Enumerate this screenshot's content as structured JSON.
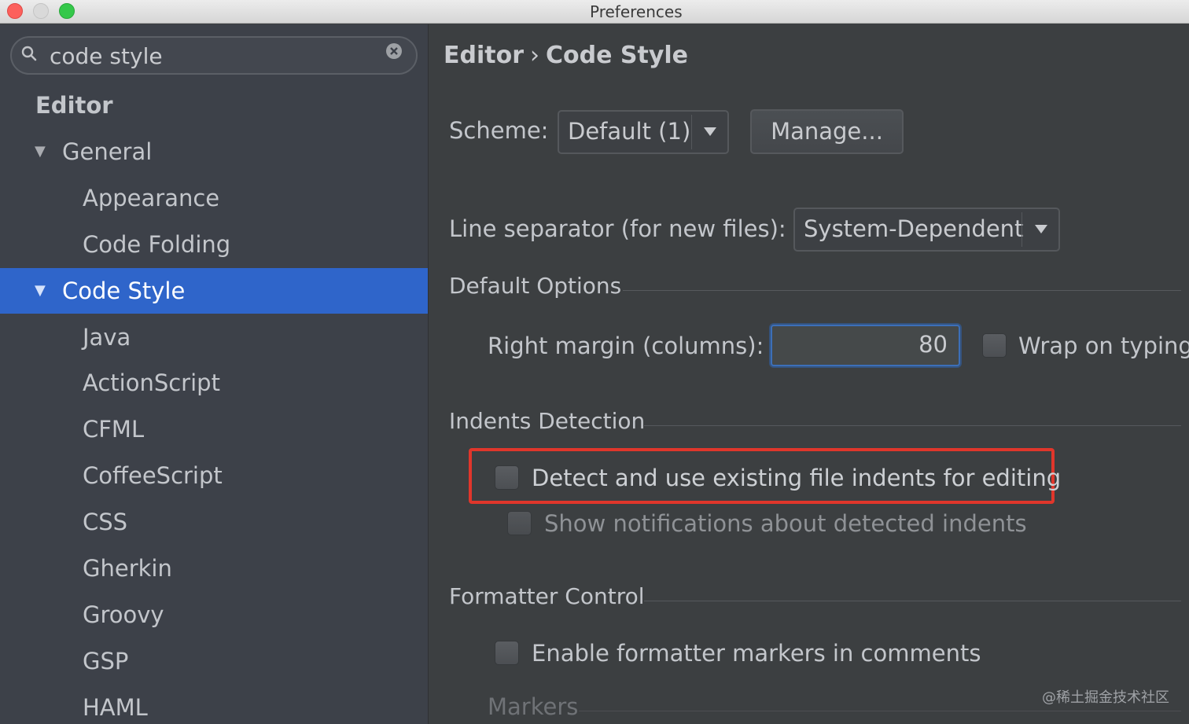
{
  "window": {
    "title": "Preferences"
  },
  "search": {
    "value": "code style"
  },
  "tree": [
    {
      "label": "Editor",
      "level": 0
    },
    {
      "label": "General",
      "level": 1,
      "expanded": true
    },
    {
      "label": "Appearance",
      "level": 2
    },
    {
      "label": "Code Folding",
      "level": 2
    },
    {
      "label": "Code Style",
      "level": 1,
      "expanded": true,
      "selected": true
    },
    {
      "label": "Java",
      "level": 2
    },
    {
      "label": "ActionScript",
      "level": 2
    },
    {
      "label": "CFML",
      "level": 2
    },
    {
      "label": "CoffeeScript",
      "level": 2
    },
    {
      "label": "CSS",
      "level": 2
    },
    {
      "label": "Gherkin",
      "level": 2
    },
    {
      "label": "Groovy",
      "level": 2
    },
    {
      "label": "GSP",
      "level": 2
    },
    {
      "label": "HAML",
      "level": 2
    }
  ],
  "breadcrumb": {
    "parent": "Editor",
    "separator": "›",
    "current": "Code Style"
  },
  "scheme": {
    "label": "Scheme:",
    "value": "Default (1)",
    "manage_label": "Manage..."
  },
  "line_separator": {
    "label": "Line separator (for new files):",
    "value": "System-Dependent"
  },
  "default_options": {
    "title": "Default Options",
    "right_margin_label": "Right margin (columns):",
    "right_margin_value": "80",
    "wrap_label": "Wrap on typing",
    "wrap_checked": false
  },
  "indents": {
    "title": "Indents Detection",
    "detect_label": "Detect and use existing file indents for editing",
    "detect_checked": false,
    "notify_label": "Show notifications about detected indents",
    "notify_checked": false
  },
  "formatter": {
    "title": "Formatter Control",
    "enable_label": "Enable formatter markers in comments",
    "enable_checked": false,
    "markers_label": "Markers"
  },
  "watermark": "@稀土掘金技术社区",
  "colors": {
    "selection": "#2f65ca",
    "highlight_border": "#e0362b",
    "focus_border": "#3c6fb8"
  }
}
